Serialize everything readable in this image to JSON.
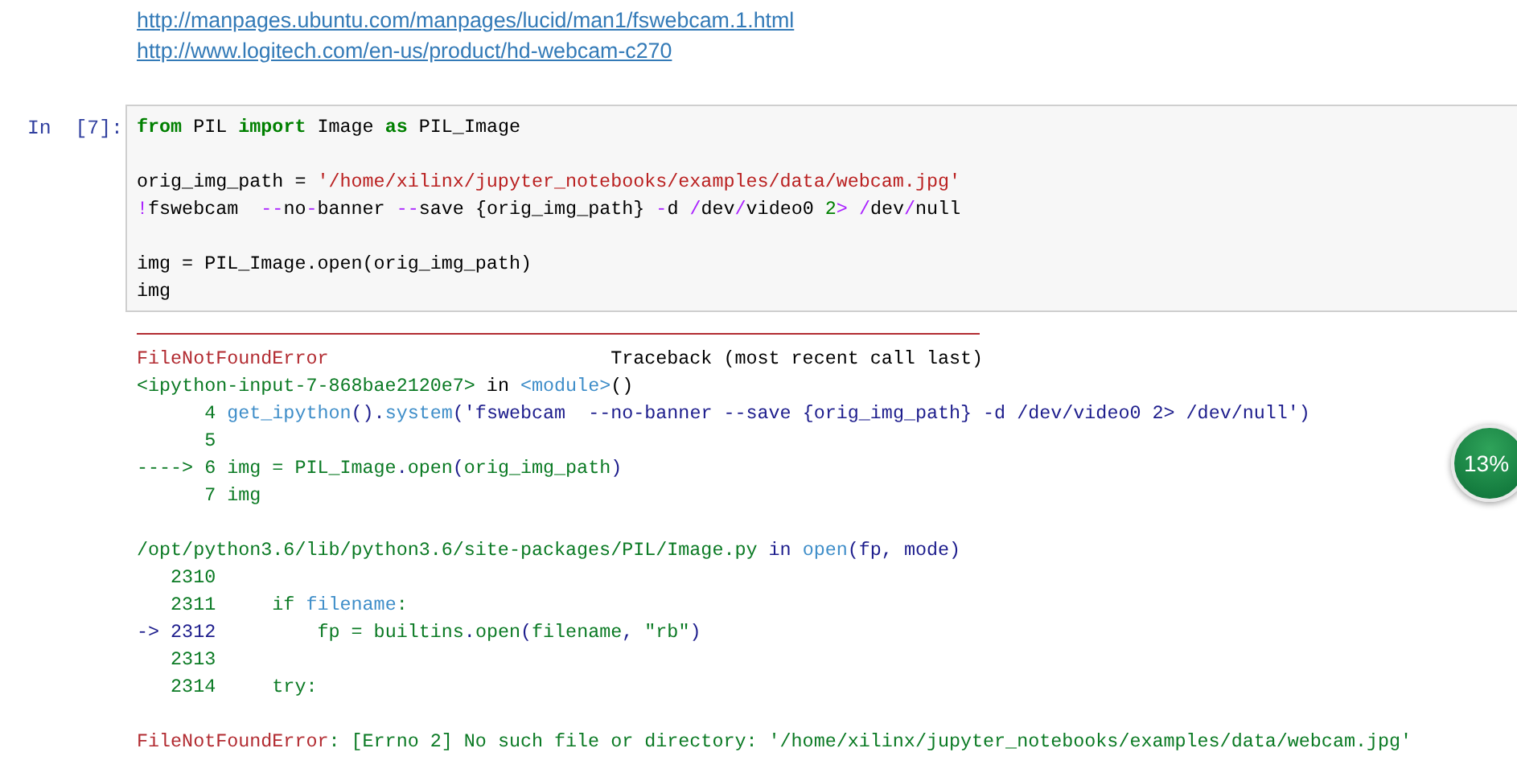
{
  "links": [
    "http://manpages.ubuntu.com/manpages/lucid/man1/fswebcam.1.html",
    "http://www.logitech.com/en-us/product/hd-webcam-c270"
  ],
  "cell": {
    "prompt": "In  [7]:",
    "blocks": [
      [
        [
          {
            "text": "from",
            "kind": "keyword"
          },
          {
            "text": " PIL ",
            "kind": "plain"
          },
          {
            "text": "import",
            "kind": "keyword"
          },
          {
            "text": " Image ",
            "kind": "plain"
          },
          {
            "text": "as",
            "kind": "keyword"
          },
          {
            "text": " PIL_Image",
            "kind": "plain"
          }
        ]
      ],
      [
        [
          {
            "text": "orig_img_path = ",
            "kind": "plain"
          },
          {
            "text": "'/home/xilinx/jupyter_notebooks/examples/data/webcam.jpg'",
            "kind": "string"
          }
        ],
        [
          {
            "text": "!",
            "kind": "op"
          },
          {
            "text": "fswebcam  ",
            "kind": "plain"
          },
          {
            "text": "--",
            "kind": "op"
          },
          {
            "text": "no",
            "kind": "plain"
          },
          {
            "text": "-",
            "kind": "op"
          },
          {
            "text": "banner ",
            "kind": "plain"
          },
          {
            "text": "--",
            "kind": "op"
          },
          {
            "text": "save {orig_img_path} ",
            "kind": "plain"
          },
          {
            "text": "-",
            "kind": "op"
          },
          {
            "text": "d ",
            "kind": "plain"
          },
          {
            "text": "/",
            "kind": "op"
          },
          {
            "text": "dev",
            "kind": "plain"
          },
          {
            "text": "/",
            "kind": "op"
          },
          {
            "text": "video0 ",
            "kind": "plain"
          },
          {
            "text": "2",
            "kind": "number"
          },
          {
            "text": "> ",
            "kind": "op"
          },
          {
            "text": "/",
            "kind": "op"
          },
          {
            "text": "dev",
            "kind": "plain"
          },
          {
            "text": "/",
            "kind": "op"
          },
          {
            "text": "null",
            "kind": "plain"
          }
        ]
      ],
      [
        [
          {
            "text": "img = PIL_Image.open(orig_img_path)",
            "kind": "plain"
          }
        ],
        [
          {
            "text": "img",
            "kind": "plain"
          }
        ]
      ]
    ]
  },
  "output": [
    [
      [
        {
          "text": "FileNotFoundError",
          "kind": "error"
        },
        {
          "text": "                         Traceback (most recent call last)",
          "kind": "plain"
        }
      ],
      [
        {
          "text": "<ipython-input-7-868bae2120e7>",
          "kind": "green"
        },
        {
          "text": " in ",
          "kind": "plain"
        },
        {
          "text": "<module>",
          "kind": "blue"
        },
        {
          "text": "()",
          "kind": "plain"
        }
      ],
      [
        {
          "text": "      4 ",
          "kind": "green"
        },
        {
          "text": "get_ipython",
          "kind": "blue"
        },
        {
          "text": "().",
          "kind": "navy"
        },
        {
          "text": "system",
          "kind": "blue"
        },
        {
          "text": "('fswebcam  --no-banner --save {orig_img_path} -d /dev/video0 2> /dev/null')",
          "kind": "navy"
        }
      ],
      [
        {
          "text": "      5",
          "kind": "green"
        }
      ],
      [
        {
          "text": "----> 6 img = PIL_Image",
          "kind": "green"
        },
        {
          "text": ".",
          "kind": "navy"
        },
        {
          "text": "open",
          "kind": "green"
        },
        {
          "text": "(",
          "kind": "navy"
        },
        {
          "text": "orig_img_path",
          "kind": "green"
        },
        {
          "text": ")",
          "kind": "navy"
        }
      ],
      [
        {
          "text": "      7 img",
          "kind": "green"
        }
      ]
    ],
    [
      [
        {
          "text": "/opt/python3.6/lib/python3.6/site-packages/PIL/Image.py",
          "kind": "green"
        },
        {
          "text": " in ",
          "kind": "navy"
        },
        {
          "text": "open",
          "kind": "blue"
        },
        {
          "text": "(fp, mode)",
          "kind": "navy"
        }
      ],
      [
        {
          "text": "   2310",
          "kind": "green"
        }
      ],
      [
        {
          "text": "   2311     if ",
          "kind": "green"
        },
        {
          "text": "filename",
          "kind": "blue"
        },
        {
          "text": ":",
          "kind": "green"
        }
      ],
      [
        {
          "text": "-> 2312",
          "kind": "navy"
        },
        {
          "text": "         fp = builtins",
          "kind": "green"
        },
        {
          "text": ".",
          "kind": "navy"
        },
        {
          "text": "open",
          "kind": "green"
        },
        {
          "text": "(",
          "kind": "navy"
        },
        {
          "text": "filename",
          "kind": "green"
        },
        {
          "text": ", ",
          "kind": "navy"
        },
        {
          "text": "\"rb\"",
          "kind": "green"
        },
        {
          "text": ")",
          "kind": "navy"
        }
      ],
      [
        {
          "text": "   2313",
          "kind": "green"
        }
      ],
      [
        {
          "text": "   2314     try:",
          "kind": "green"
        }
      ]
    ],
    [
      [
        {
          "text": "FileNotFoundError",
          "kind": "error"
        },
        {
          "text": ": [Errno 2] No such file or directory: '/home/xilinx/jupyter_notebooks/examples/data/webcam.jpg'",
          "kind": "green"
        }
      ]
    ]
  ],
  "progress_badge": {
    "text": "13%"
  }
}
